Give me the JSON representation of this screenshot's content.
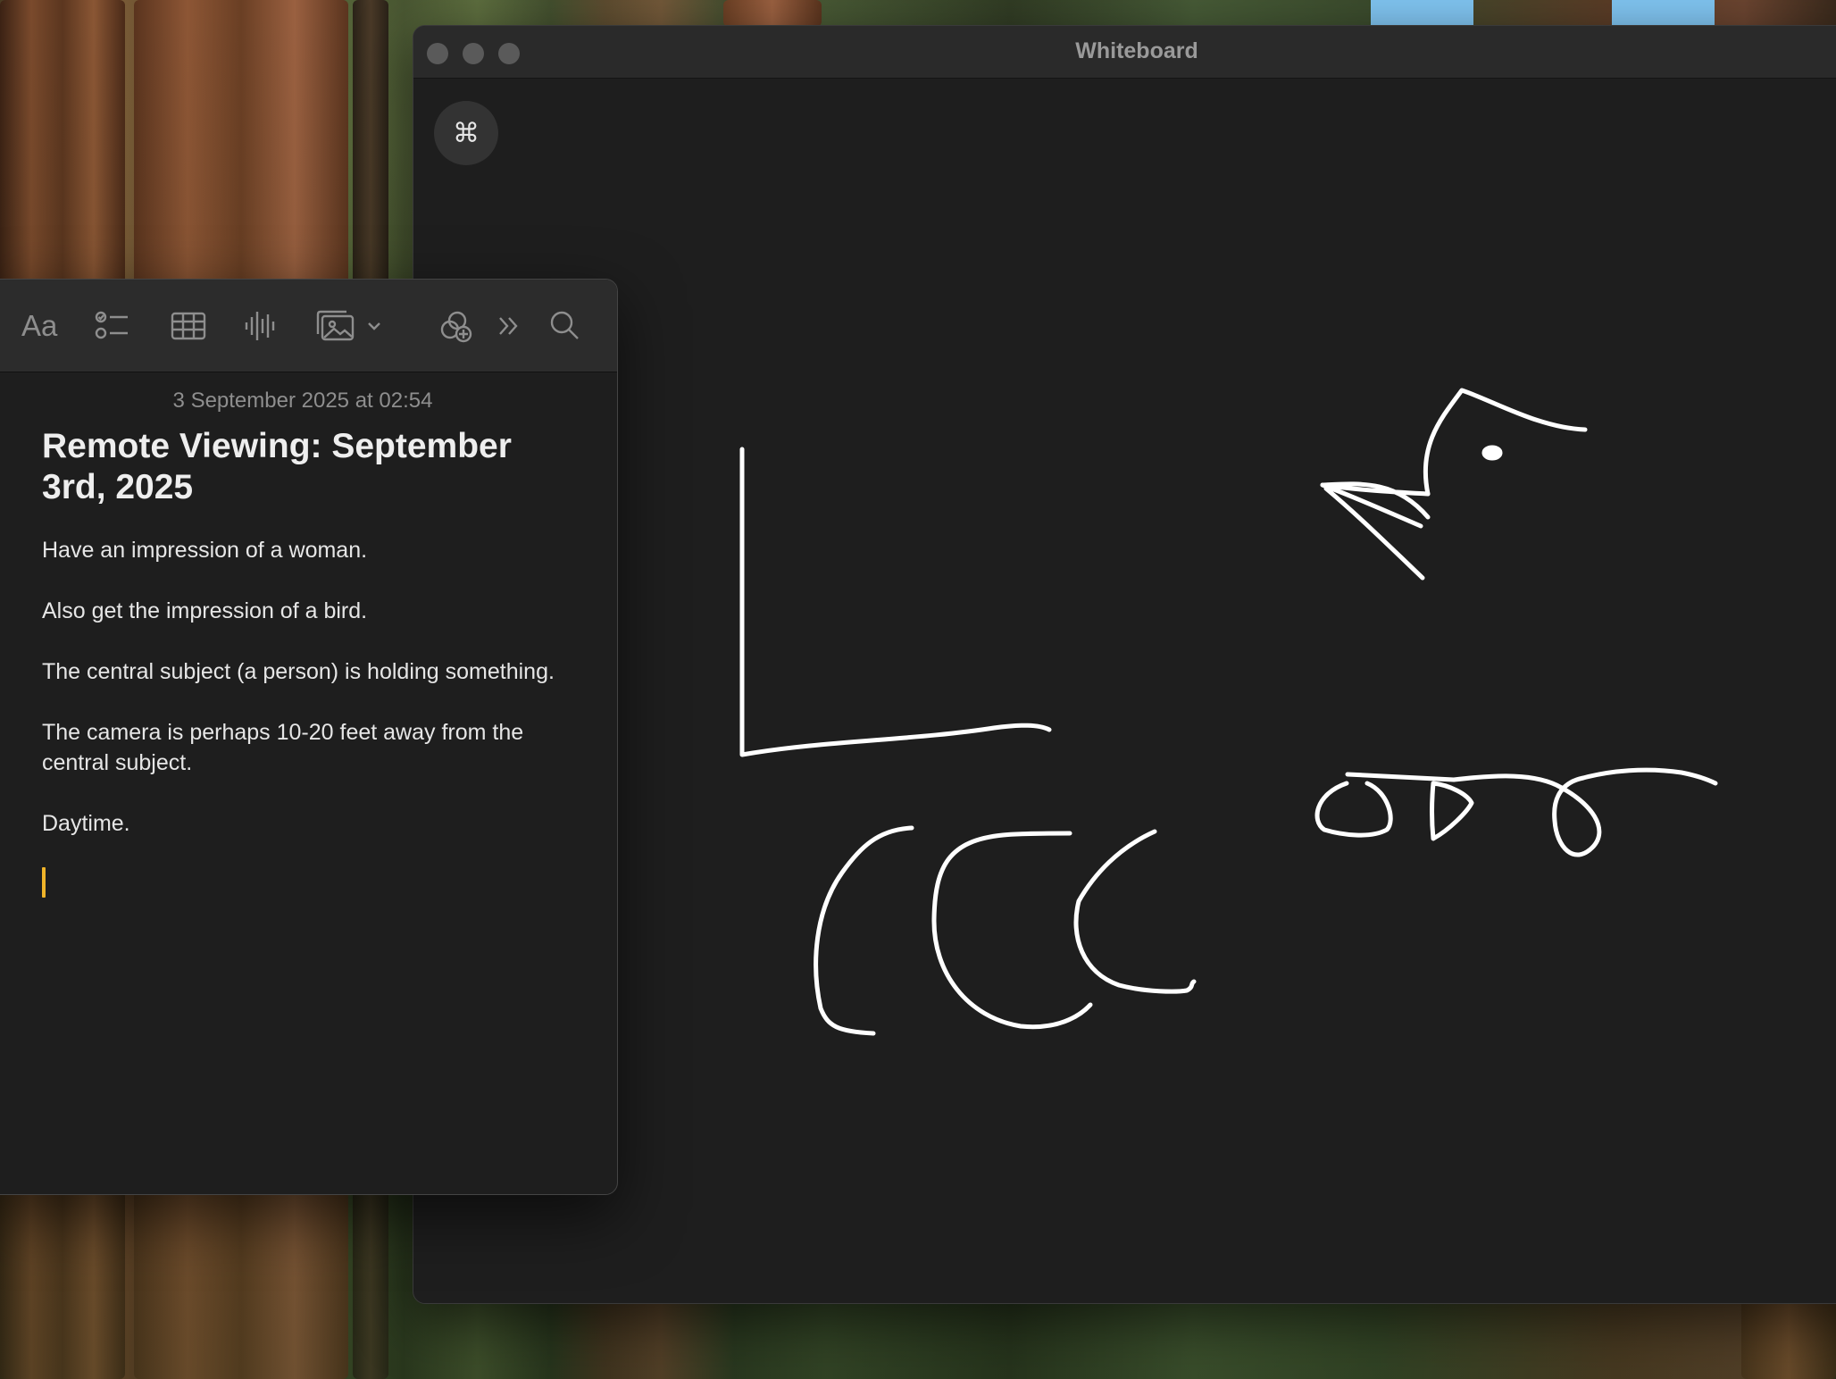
{
  "whiteboard": {
    "title": "Whiteboard",
    "command_button_glyph": "⌘"
  },
  "notes": {
    "toolbar": {
      "format_label": "Aa",
      "icons": [
        "checklist-icon",
        "table-icon",
        "audio-waveform-icon",
        "media-icon",
        "chevron-down-icon",
        "collaborate-icon",
        "more-chevrons-icon",
        "search-icon"
      ]
    },
    "date": "3 September 2025 at 02:54",
    "title": "Remote Viewing: September 3rd, 2025",
    "paragraphs": [
      "Have an impression of a woman.",
      "Also get the impression of a bird.",
      "The central subject (a person) is holding something.",
      "The camera is perhaps 10-20 feet away from the central subject.",
      "Daytime."
    ]
  },
  "colors": {
    "caret": "#f0b429",
    "window_bg": "#1e1e1e",
    "toolbar_bg": "#2c2c2c",
    "stroke": "#ffffff"
  }
}
